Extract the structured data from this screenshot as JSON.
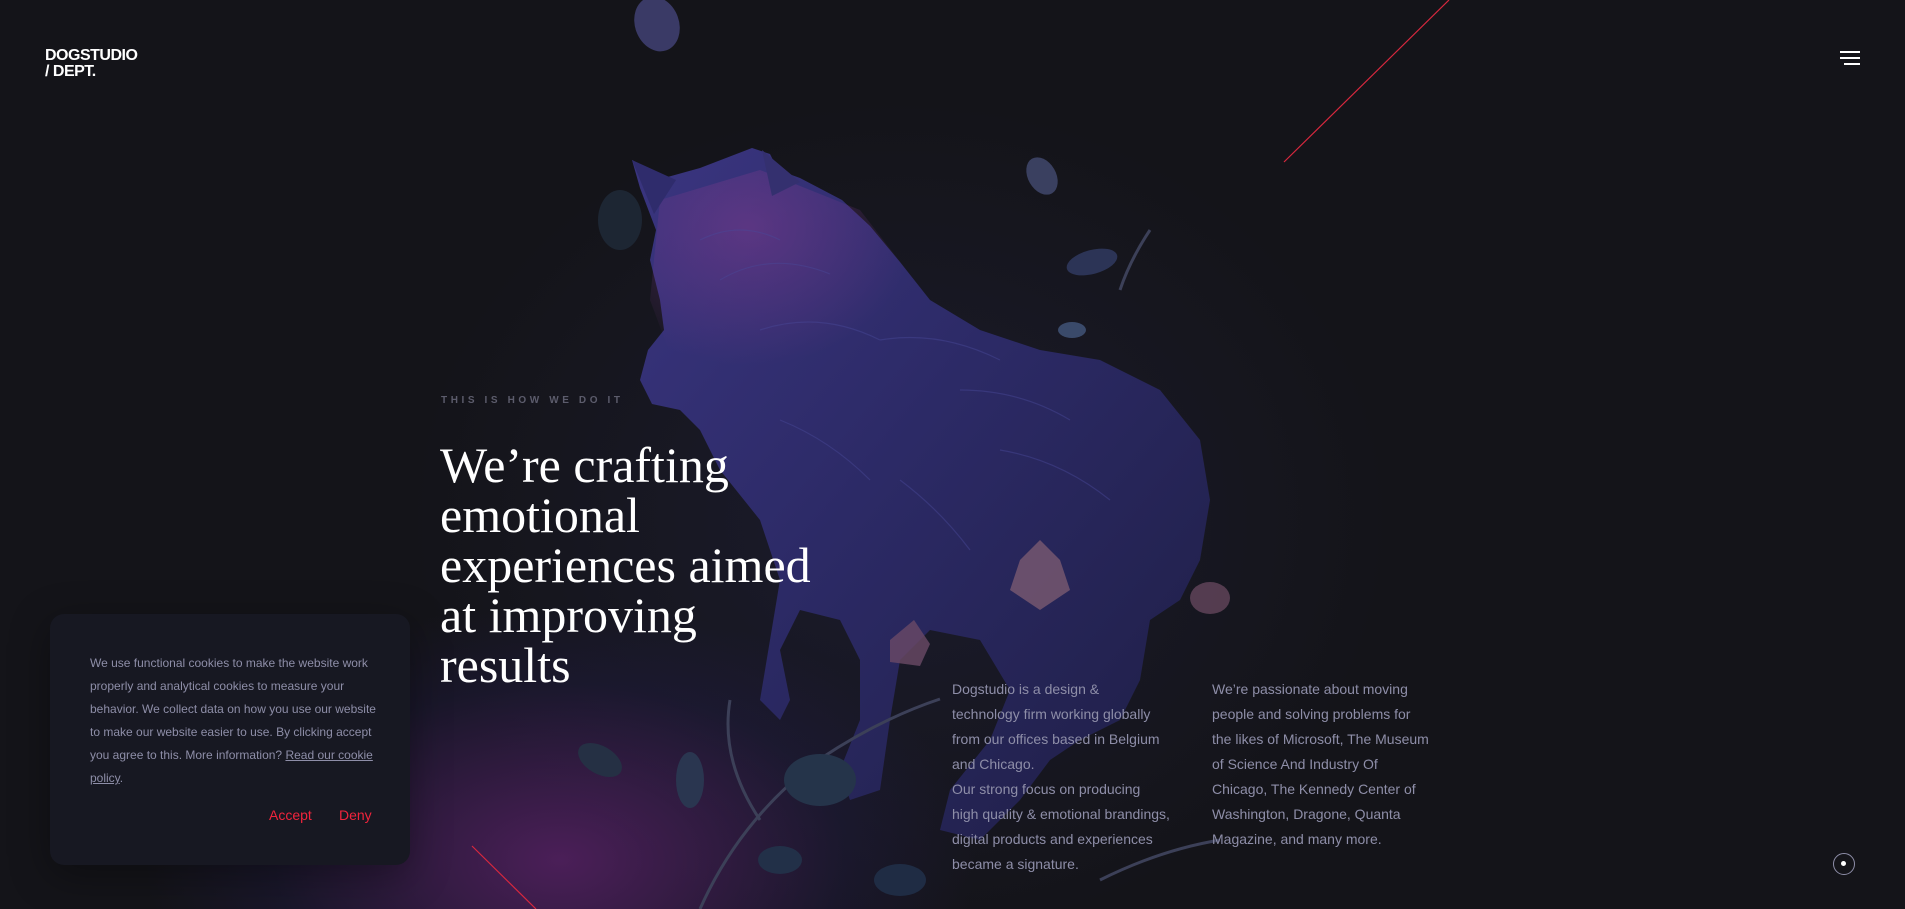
{
  "header": {
    "logo_line1": "DOGSTUDIO",
    "logo_line2": "/ DEPT.",
    "menu_icon": "hamburger-menu-icon"
  },
  "hero": {
    "eyebrow": "THIS IS HOW WE DO IT",
    "headline_lines": [
      "We’re crafting",
      "emotional",
      "experiences aimed",
      "at improving",
      "results"
    ],
    "illustration": "wolf-with-leaves-illustration"
  },
  "about": {
    "left_paragraph_1": "Dogstudio is a design & technology firm working globally from our offices based in Belgium and Chicago.",
    "left_paragraph_2": "Our strong focus on producing high quality & emotional brandings, digital products and experiences became a signature.",
    "right_paragraph": "We’re passionate about moving people and solving problems for the likes of Microsoft, The Museum of Science And Industry Of Chicago, The Kennedy Center of Washington, Dragone, Quanta Magazine, and many more."
  },
  "cookie_banner": {
    "text": "We use functional cookies to make the website work properly and analytical cookies to measure your behavior. We collect data on how you use our website to make our website easier to use. By clicking accept you agree to this. More information?",
    "link_text": "Read our cookie policy",
    "link_suffix": ".",
    "accept_label": "Accept",
    "deny_label": "Deny"
  },
  "colors": {
    "background": "#141419",
    "accent": "#f0243c",
    "body_text": "#8e8ea8",
    "heading_text": "#ffffff"
  },
  "scroll_indicator_icon": "scroll-indicator-icon"
}
